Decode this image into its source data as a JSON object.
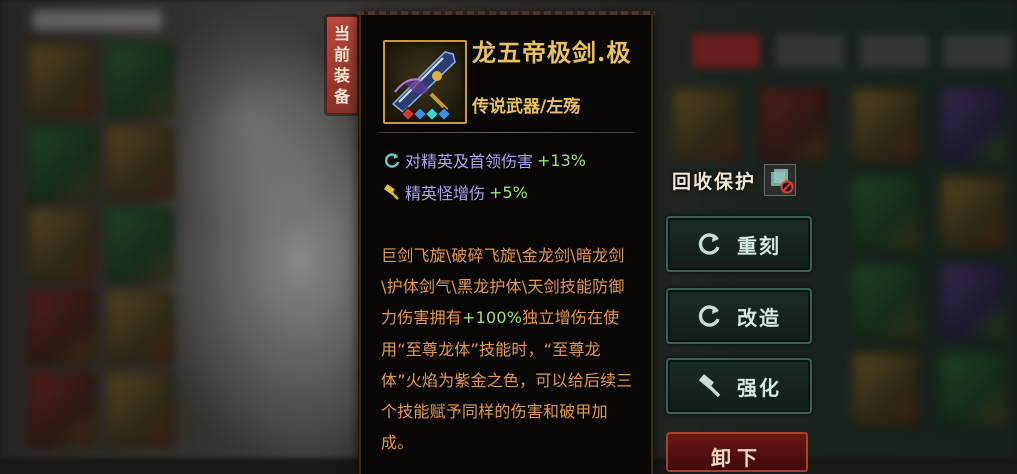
{
  "badge": {
    "chars": [
      "当",
      "前",
      "装",
      "备"
    ]
  },
  "item": {
    "name": "龙五帝极剑.极",
    "type": "传说武器/左殇",
    "affixes": [
      {
        "icon": "refresh-icon",
        "text": "对精英及首领伤害",
        "value": "+13%"
      },
      {
        "icon": "hammer-icon",
        "text": "精英怪增伤",
        "value": "+5%"
      }
    ],
    "desc_pre": "巨剑飞旋\\破碎飞旋\\金龙剑\\暗龙剑\\护体剑气\\黑龙护体\\天剑技能防御力伤害拥有",
    "desc_value": "+100%",
    "desc_post": "独立增伤在使用“至尊龙体”技能时，“至尊龙体”火焰为紫金之色，可以给后续三个技能赋予同样的伤害和破甲加成。",
    "gem_colors": [
      "#d33a2a",
      "#3a8ee0",
      "#3fd0d0",
      "#3a8ee0"
    ]
  },
  "recycle": {
    "label": "回收保护"
  },
  "actions": {
    "recarve": "重刻",
    "reforge": "改造",
    "enhance": "强化",
    "unequip": "卸下"
  },
  "colors": {
    "gold": "#e9c15f",
    "affix_text": "#a7a7f0",
    "affix_value": "#9fe07a",
    "desc": "#e39a4e"
  }
}
